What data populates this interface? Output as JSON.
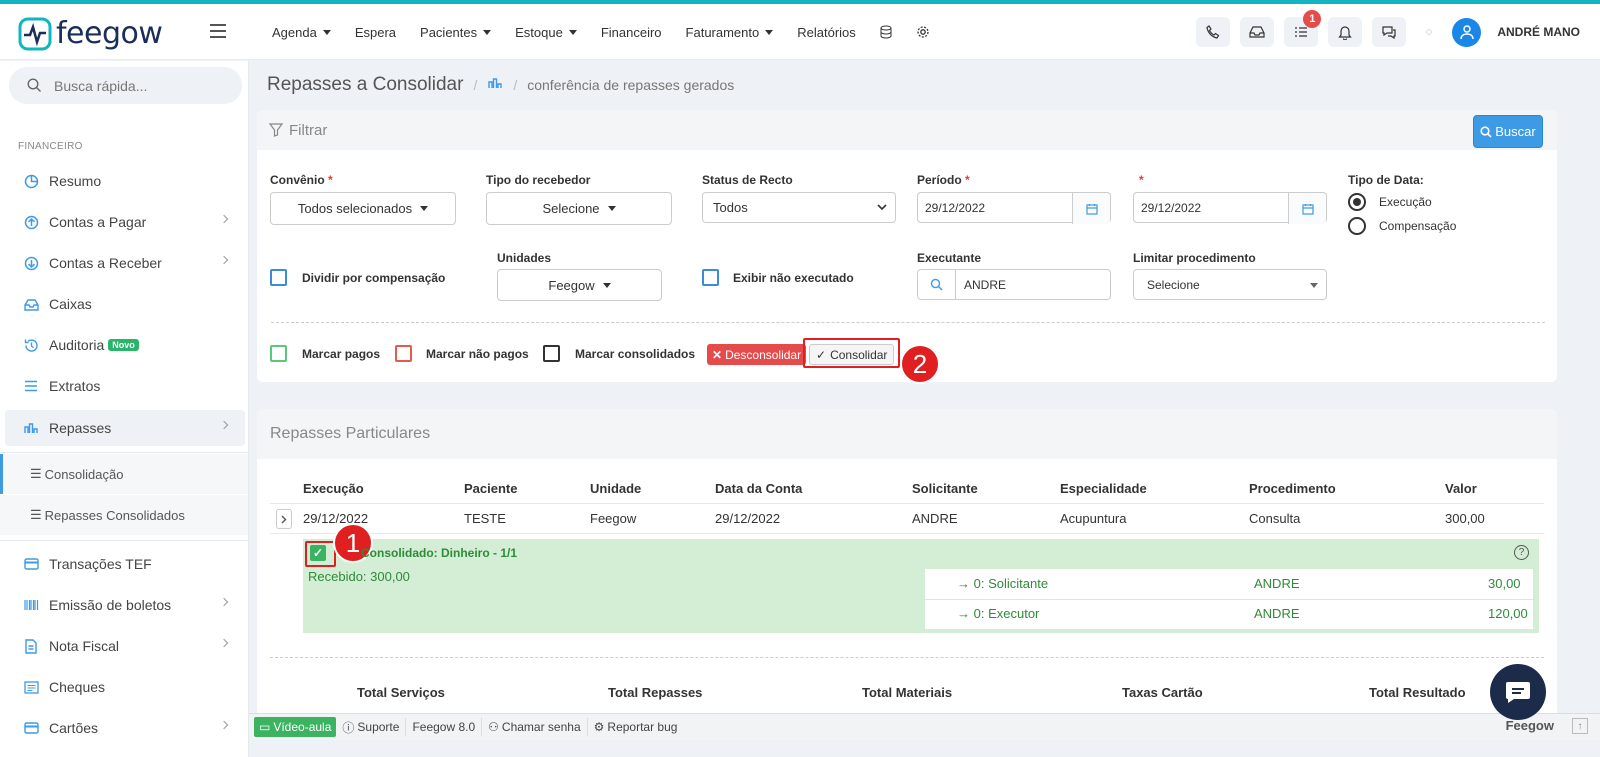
{
  "app": {
    "logo_text": "feegow",
    "user_name": "ANDRÉ MANO",
    "notif_count": "1"
  },
  "nav": {
    "items": [
      {
        "label": "Agenda",
        "caret": true
      },
      {
        "label": "Espera",
        "caret": false
      },
      {
        "label": "Pacientes",
        "caret": true
      },
      {
        "label": "Estoque",
        "caret": true
      },
      {
        "label": "Financeiro",
        "caret": false
      },
      {
        "label": "Faturamento",
        "caret": true
      },
      {
        "label": "Relatórios",
        "caret": false
      }
    ]
  },
  "sidebar": {
    "search_placeholder": "Busca rápida...",
    "section": "FINANCEIRO",
    "items": [
      {
        "label": "Resumo",
        "icon": "chart-pie-icon"
      },
      {
        "label": "Contas a Pagar",
        "icon": "arrow-up-circle-icon"
      },
      {
        "label": "Contas a Receber",
        "icon": "arrow-down-circle-icon"
      },
      {
        "label": "Caixas",
        "icon": "inbox-icon"
      },
      {
        "label": "Auditoria",
        "icon": "history-icon",
        "badge": "Novo"
      },
      {
        "label": "Extratos",
        "icon": "list-icon"
      },
      {
        "label": "Repasses",
        "icon": "repasses-icon"
      }
    ],
    "subitems": [
      {
        "label": "Consolidação"
      },
      {
        "label": "Repasses Consolidados"
      }
    ],
    "items2": [
      {
        "label": "Transações TEF",
        "icon": "card-icon"
      },
      {
        "label": "Emissão de boletos",
        "icon": "barcode-icon"
      },
      {
        "label": "Nota Fiscal",
        "icon": "document-icon"
      },
      {
        "label": "Cheques",
        "icon": "cheque-icon"
      },
      {
        "label": "Cartões",
        "icon": "card-icon"
      }
    ]
  },
  "breadcrumb": {
    "title": "Repasses a Consolidar",
    "sub": "conferência de repasses gerados"
  },
  "filter": {
    "title": "Filtrar",
    "buscar": "Buscar",
    "convenio_label": "Convênio",
    "convenio_value": "Todos selecionados",
    "tipo_receb_label": "Tipo do recebedor",
    "tipo_receb_value": "Selecione",
    "status_label": "Status de Recto",
    "status_value": "Todos",
    "periodo_label": "Período",
    "periodo_from": "29/12/2022",
    "periodo_to": "29/12/2022",
    "tipo_data_label": "Tipo de Data:",
    "tipo_data_opt1": "Execução",
    "tipo_data_opt2": "Compensação",
    "dividir_label": "Dividir por compensação",
    "unidades_label": "Unidades",
    "unidades_value": "Feegow",
    "exibir_label": "Exibir não executado",
    "executante_label": "Executante",
    "executante_value": "ANDRE",
    "limitar_label": "Limitar procedimento",
    "limitar_value": "Selecione",
    "marcar_pagos": "Marcar pagos",
    "marcar_nao_pagos": "Marcar não pagos",
    "marcar_consolidados": "Marcar consolidados",
    "desconsolidar": "Desconsolidar",
    "consolidar": "Consolidar"
  },
  "annotations": {
    "one": "1",
    "two": "2"
  },
  "table": {
    "title": "Repasses Particulares",
    "headers": [
      "Execução",
      "Paciente",
      "Unidade",
      "Data da Conta",
      "Solicitante",
      "Especialidade",
      "Procedimento",
      "Valor"
    ],
    "row": [
      "29/12/2022",
      "TESTE",
      "Feegow",
      "29/12/2022",
      "ANDRE",
      "Acupuntura",
      "Consulta",
      "300,00"
    ],
    "detail": {
      "status": "Consolidado: Dinheiro - 1/1",
      "recebido": "Recebido: 300,00",
      "lines": [
        {
          "role": "0: Solicitante",
          "name": "ANDRE",
          "value": "30,00"
        },
        {
          "role": "0: Executor",
          "name": "ANDRE",
          "value": "120,00"
        }
      ]
    },
    "totals": [
      "Total Serviços",
      "Total Repasses",
      "Total Materiais",
      "Taxas Cartão",
      "Total Resultado"
    ]
  },
  "footer": {
    "video": "Vídeo-aula",
    "suporte": "Suporte",
    "version": "Feegow 8.0",
    "chamar": "Chamar senha",
    "bug": "Reportar bug",
    "brand": "Feegow"
  }
}
